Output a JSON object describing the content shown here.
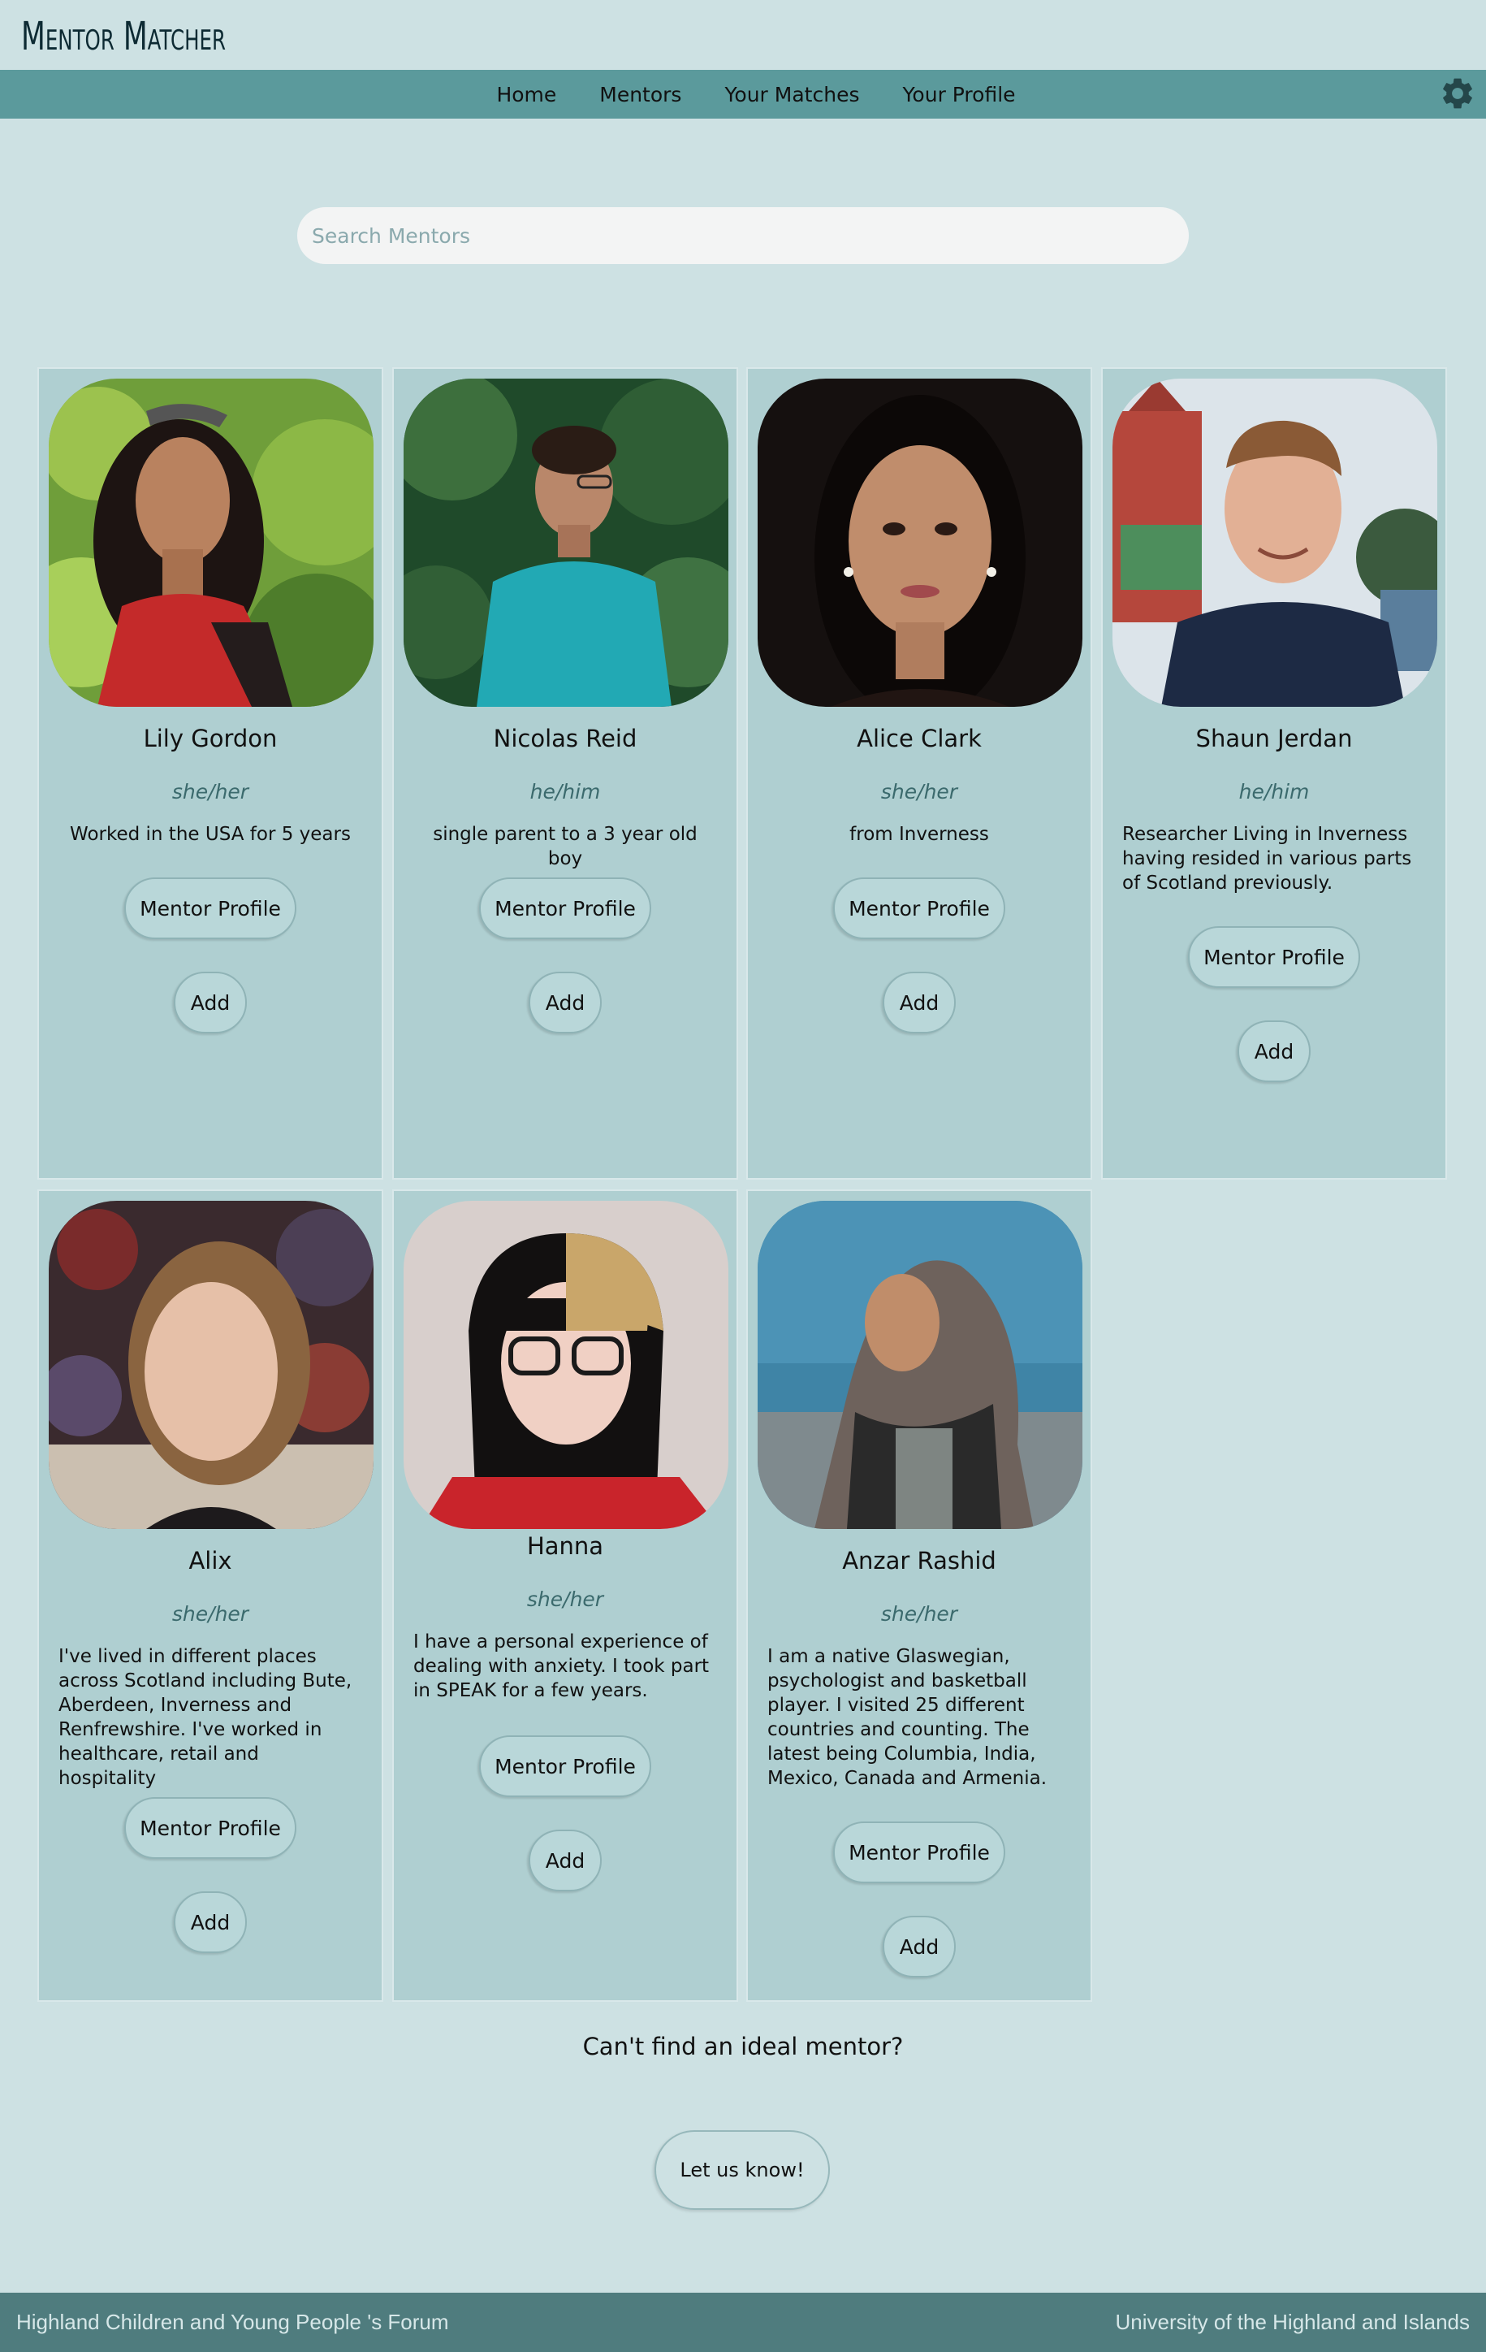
{
  "app": {
    "title": "Mentor Matcher"
  },
  "nav": {
    "items": [
      "Home",
      "Mentors",
      "Your Matches",
      "Your Profile"
    ]
  },
  "settings_icon": "gear-icon",
  "search": {
    "placeholder": "Search Mentors",
    "value": ""
  },
  "mentors": [
    {
      "name": "Lily Gordon",
      "pronouns": "she/her",
      "bio": "Worked in the USA for 5 years",
      "profile_label": "Mentor Profile",
      "add_label": "Add"
    },
    {
      "name": "Nicolas Reid",
      "pronouns": "he/him",
      "bio": "single parent to a 3 year old boy",
      "profile_label": "Mentor Profile",
      "add_label": "Add"
    },
    {
      "name": "Alice Clark",
      "pronouns": "she/her",
      "bio": "from Inverness",
      "profile_label": "Mentor Profile",
      "add_label": "Add"
    },
    {
      "name": "Shaun Jerdan",
      "pronouns": "he/him",
      "bio": "Researcher Living in Inverness having resided in various parts of Scotland previously.",
      "profile_label": "Mentor Profile",
      "add_label": "Add"
    },
    {
      "name": "Alix",
      "pronouns": "she/her",
      "bio": "I've lived in different places across Scotland including Bute, Aberdeen, Inverness and Renfrewshire. I've worked in healthcare, retail and hospitality",
      "profile_label": "Mentor Profile",
      "add_label": "Add"
    },
    {
      "name": "Hanna",
      "pronouns": "she/her",
      "bio": "I have a personal experience of dealing with anxiety. I took part in SPEAK for a few years.",
      "profile_label": "Mentor Profile",
      "add_label": "Add"
    },
    {
      "name": "Anzar Rashid",
      "pronouns": "she/her",
      "bio": "I am a native Glaswegian, psychologist and basketball player. I visited 25 different countries and counting. The latest being Columbia, India, Mexico, Canada and Armenia.",
      "profile_label": "Mentor Profile",
      "add_label": "Add"
    }
  ],
  "cta": {
    "question": "Can't find an ideal mentor?",
    "button": "Let us know!"
  },
  "footer": {
    "left": "Highland Children and Young People 's Forum",
    "right": "University of the Highland and Islands"
  },
  "colors": {
    "background": "#cde1e3",
    "navbar": "#5b9a9c",
    "card": "#afcfd1",
    "footer": "#4f7c7e",
    "pronoun": "#3b6a6d"
  }
}
